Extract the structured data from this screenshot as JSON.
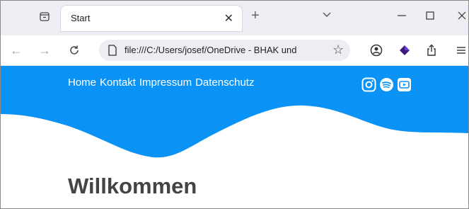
{
  "browser": {
    "tab": {
      "title": "Start",
      "close": "✕"
    },
    "new_tab": "+",
    "address": {
      "url": "file:///C:/Users/josef/OneDrive - BHAK und"
    }
  },
  "site": {
    "nav": [
      "Home",
      "Kontakt",
      "Impressum",
      "Datenschutz"
    ],
    "heading": "Willkommen",
    "social": [
      "instagram-icon",
      "spotify-icon",
      "youtube-icon"
    ]
  },
  "colors": {
    "accent": "#0b92f5",
    "tabstrip": "#eceef3",
    "heading": "#444444"
  }
}
